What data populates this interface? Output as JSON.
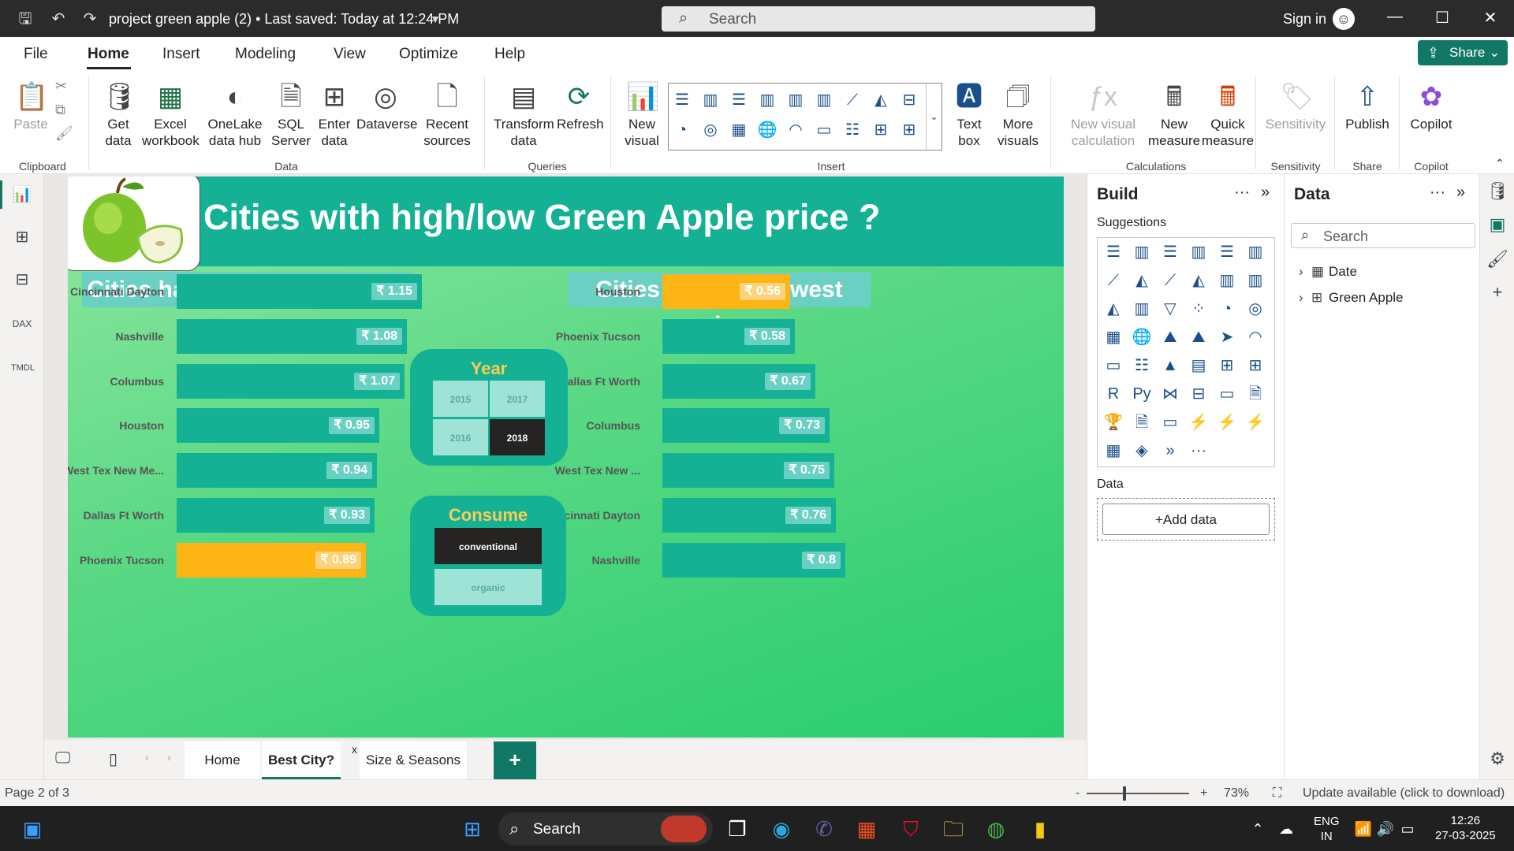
{
  "app": {
    "title": "project green apple (2) • Last saved: Today at 12:24 PM",
    "search_placeholder": "Search",
    "sign_in": "Sign in"
  },
  "menu": {
    "tabs": [
      "File",
      "Home",
      "Insert",
      "Modeling",
      "View",
      "Optimize",
      "Help"
    ],
    "active": "Home",
    "share": "Share"
  },
  "ribbon": {
    "clipboard": {
      "paste": "Paste",
      "group": "Clipboard"
    },
    "data": {
      "get_data": "Get data",
      "excel": "Excel workbook",
      "onelake": "OneLake data hub",
      "sql": "SQL Server",
      "enter": "Enter data",
      "dataverse": "Dataverse",
      "recent": "Recent sources",
      "group": "Data"
    },
    "queries": {
      "transform": "Transform data",
      "refresh": "Refresh",
      "group": "Queries"
    },
    "insert": {
      "new_visual": "New visual",
      "text_box": "Text box",
      "more_visuals": "More visuals",
      "group": "Insert"
    },
    "calculations": {
      "new_visual_calc": "New visual calculation",
      "new_measure": "New measure",
      "quick_measure": "Quick measure",
      "group": "Calculations"
    },
    "sensitivity": {
      "label": "Sensitivity",
      "group": "Sensitivity"
    },
    "share": {
      "publish": "Publish",
      "group": "Share"
    },
    "copilot": {
      "label": "Copilot",
      "group": "Copilot"
    }
  },
  "report": {
    "title": "Cities with  high/low Green Apple price ?",
    "highest_title": "Cities have the highest price",
    "lowest_title": "Cities have the lowest price",
    "highest": [
      {
        "city": "Cincinnati Dayton",
        "value": 1.15,
        "label": "₹ 1.15",
        "highlight": false
      },
      {
        "city": "Nashville",
        "value": 1.08,
        "label": "₹ 1.08",
        "highlight": false
      },
      {
        "city": "Columbus",
        "value": 1.07,
        "label": "₹ 1.07",
        "highlight": false
      },
      {
        "city": "Houston",
        "value": 0.95,
        "label": "₹ 0.95",
        "highlight": false
      },
      {
        "city": "West Tex New Me...",
        "value": 0.94,
        "label": "₹ 0.94",
        "highlight": false
      },
      {
        "city": "Dallas Ft Worth",
        "value": 0.93,
        "label": "₹ 0.93",
        "highlight": false
      },
      {
        "city": "Phoenix Tucson",
        "value": 0.89,
        "label": "₹ 0.89",
        "highlight": true
      }
    ],
    "lowest": [
      {
        "city": "Houston",
        "value": 0.56,
        "label": "₹ 0.56",
        "highlight": true
      },
      {
        "city": "Phoenix Tucson",
        "value": 0.58,
        "label": "₹ 0.58",
        "highlight": false
      },
      {
        "city": "Dallas Ft Worth",
        "value": 0.67,
        "label": "₹ 0.67",
        "highlight": false
      },
      {
        "city": "Columbus",
        "value": 0.73,
        "label": "₹ 0.73",
        "highlight": false
      },
      {
        "city": "West Tex New ...",
        "value": 0.75,
        "label": "₹ 0.75",
        "highlight": false
      },
      {
        "city": "Cincinnati Dayton",
        "value": 0.76,
        "label": "₹ 0.76",
        "highlight": false
      },
      {
        "city": "Nashville",
        "value": 0.8,
        "label": "₹ 0.8",
        "highlight": false
      }
    ],
    "year_slicer": {
      "title": "Year",
      "options": [
        "2015",
        "2017",
        "2016",
        "2018"
      ],
      "selected": "2018"
    },
    "consume_slicer": {
      "title": "Consume",
      "options": [
        "conventional",
        "organic"
      ],
      "selected": "conventional"
    },
    "colors": {
      "bar": "#14b195",
      "highlight": "#fdb515",
      "header": "#14b195"
    }
  },
  "chart_data": [
    {
      "type": "bar",
      "title": "Cities have the highest price",
      "categories": [
        "Cincinnati Dayton",
        "Nashville",
        "Columbus",
        "Houston",
        "West Tex New Me...",
        "Dallas Ft Worth",
        "Phoenix Tucson"
      ],
      "values": [
        1.15,
        1.08,
        1.07,
        0.95,
        0.94,
        0.93,
        0.89
      ]
    },
    {
      "type": "bar",
      "title": "Cities have the lowest price",
      "categories": [
        "Houston",
        "Phoenix Tucson",
        "Dallas Ft Worth",
        "Columbus",
        "West Tex New ...",
        "Cincinnati Dayton",
        "Nashville"
      ],
      "values": [
        0.56,
        0.58,
        0.67,
        0.73,
        0.75,
        0.76,
        0.8
      ]
    }
  ],
  "pages": {
    "tabs": [
      "Home",
      "Best City?",
      "Size & Seasons"
    ],
    "active": "Best City?",
    "add": "+",
    "close": "x"
  },
  "build": {
    "title": "Build",
    "suggestions": "Suggestions",
    "data_label": "Data",
    "add_data": "+Add data",
    "more": "···"
  },
  "data_pane": {
    "title": "Data",
    "search_placeholder": "Search",
    "tables": [
      "Date",
      "Green Apple"
    ]
  },
  "status": {
    "page": "Page 2 of 3",
    "zoom": "73%",
    "update": "Update available (click to download)",
    "minus": "-",
    "plus": "+"
  },
  "taskbar": {
    "search": "Search",
    "lang": "ENG",
    "region": "IN",
    "time": "12:26",
    "date": "27-03-2025"
  }
}
